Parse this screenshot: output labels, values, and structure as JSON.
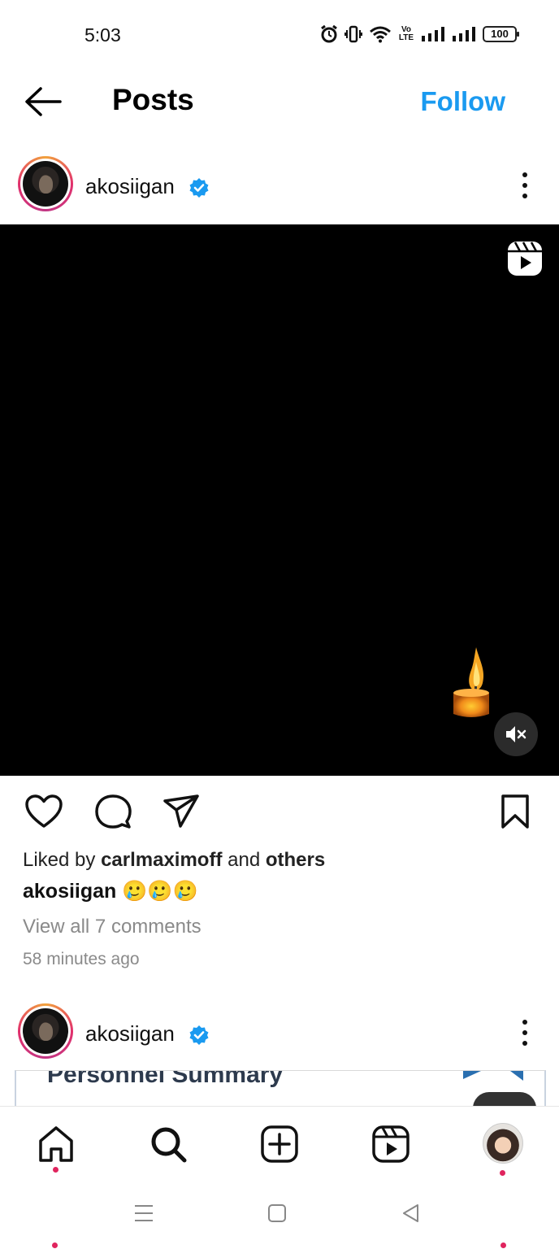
{
  "status_bar": {
    "time": "5:03",
    "battery": "100",
    "volte": "Vo LTE"
  },
  "header": {
    "title": "Posts",
    "follow_label": "Follow"
  },
  "post": {
    "username": "akosiigan",
    "verified": true,
    "media_type": "reel",
    "likes_prefix": "Liked by",
    "liked_by_user": "carlmaximoff",
    "likes_and": "and",
    "likes_others": "others",
    "caption_username": "akosiigan",
    "caption_text": "🥲🥲🥲",
    "view_comments": "View all 7 comments",
    "timestamp": "58 minutes ago"
  },
  "next_post": {
    "username": "akosiigan",
    "verified": true,
    "preview_text": "Personnel Summary"
  },
  "bottom_nav": {
    "items": [
      "home-icon",
      "search-icon",
      "create-icon",
      "reels-icon",
      "profile-avatar"
    ],
    "active": "search"
  },
  "colors": {
    "follow": "#1a9af0",
    "verified": "#1a9af0",
    "notification_dot": "#e0245e"
  }
}
